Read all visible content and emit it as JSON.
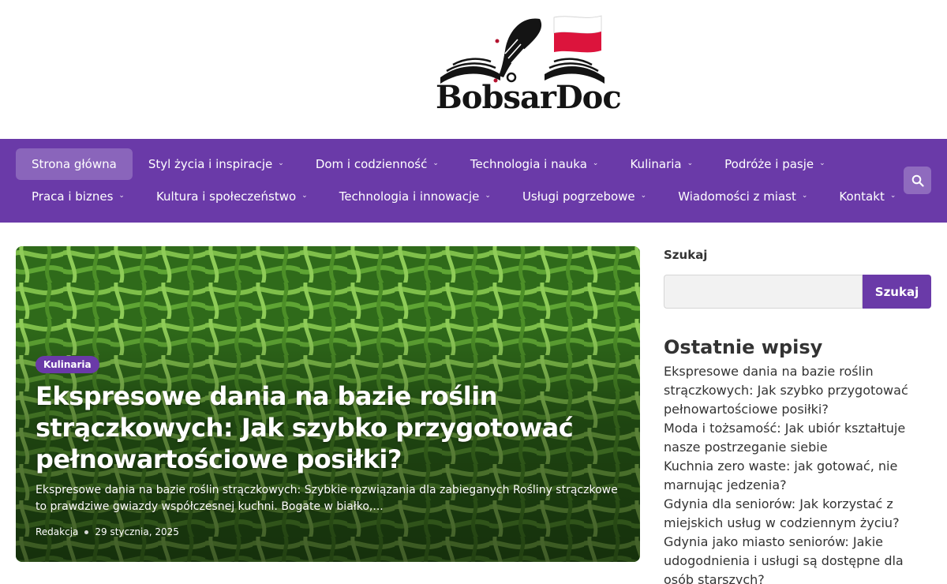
{
  "site": {
    "logo_text": "BobsarDoc",
    "logo_colors": {
      "flag_top": "#ffffff",
      "flag_bottom": "#dc143c",
      "ink": "#141414",
      "drop": "#b3122e"
    }
  },
  "colors": {
    "accent": "#6a3aa8",
    "nav_text": "#ffffff"
  },
  "nav": {
    "row1": [
      {
        "label": "Strona główna",
        "active": true,
        "has_dropdown": false
      },
      {
        "label": "Styl życia i inspiracje",
        "has_dropdown": true
      },
      {
        "label": "Dom i codzienność",
        "has_dropdown": true
      },
      {
        "label": "Technologia i nauka",
        "has_dropdown": true
      },
      {
        "label": "Kulinaria",
        "has_dropdown": true
      },
      {
        "label": "Podróże i pasje",
        "has_dropdown": true
      }
    ],
    "row2": [
      {
        "label": "Praca i biznes",
        "has_dropdown": true
      },
      {
        "label": "Kultura i społeczeństwo",
        "has_dropdown": true
      },
      {
        "label": "Technologia i innowacje",
        "has_dropdown": true
      },
      {
        "label": "Usługi pogrzebowe",
        "has_dropdown": true
      },
      {
        "label": "Wiadomości z miast",
        "has_dropdown": true
      },
      {
        "label": "Kontakt",
        "has_dropdown": true
      }
    ],
    "search_icon": "search-icon"
  },
  "featured": {
    "category": "Kulinaria",
    "title": "Ekspresowe dania na bazie roślin strączkowych: Jak szybko przygotować pełnowartościowe posiłki?",
    "excerpt": "Ekspresowe dania na bazie roślin strączkowych: Szybkie rozwiązania dla zabieganych Rośliny strączkowe to prawdziwe gwiazdy współczesnej kuchni. Bogate w białko,...",
    "author": "Redakcja",
    "date": "29 stycznia, 2025"
  },
  "sidebar": {
    "search_label": "Szukaj",
    "search_placeholder": "",
    "search_button": "Szukaj",
    "recent_heading": "Ostatnie wpisy",
    "recent_posts": [
      "Ekspresowe dania na bazie roślin strączkowych: Jak szybko przygotować pełnowartościowe posiłki?",
      "Moda i tożsamość: Jak ubiór kształtuje nasze postrzeganie siebie",
      "Kuchnia zero waste: jak gotować, nie marnując jedzenia?",
      "Gdynia dla seniorów: Jak korzystać z miejskich usług w codziennym życiu?",
      "Gdynia jako miasto seniorów: Jakie udogodnienia i usługi są dostępne dla osób starszych?"
    ]
  }
}
